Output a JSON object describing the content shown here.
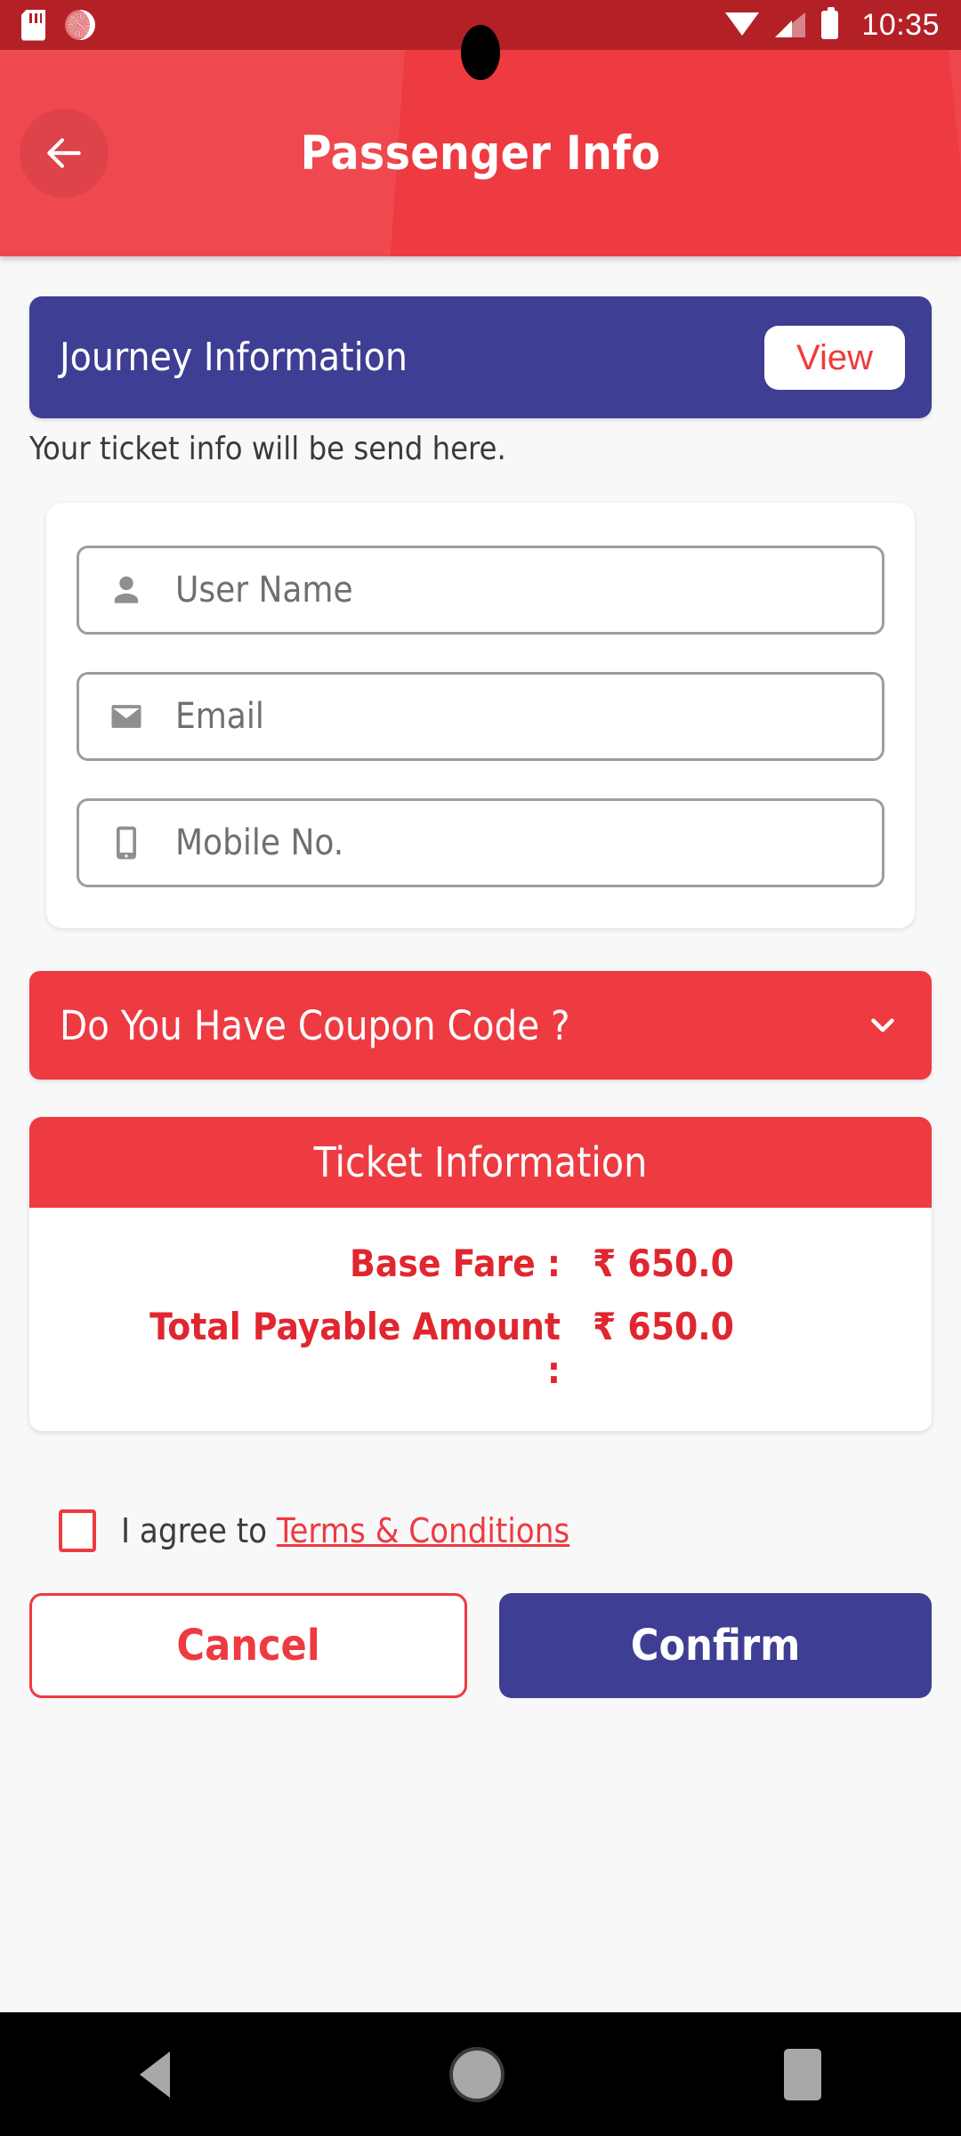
{
  "status_bar": {
    "time": "10:35",
    "left_icons": [
      "sd-card-icon",
      "brightness-icon"
    ],
    "right_icons": [
      "wifi-icon",
      "signal-icon",
      "battery-icon"
    ],
    "background_color": "#b32127"
  },
  "app_bar": {
    "title": "Passenger Info",
    "back_icon": "arrow-left-icon",
    "background_color": "#ee3a41"
  },
  "journey": {
    "title": "Journey Information",
    "view_label": "View",
    "note": "Your ticket info will be send here.",
    "card_color": "#3e3e94"
  },
  "form": {
    "fields": [
      {
        "icon": "person-icon",
        "placeholder": "User Name",
        "value": ""
      },
      {
        "icon": "envelope-icon",
        "placeholder": "Email",
        "value": ""
      },
      {
        "icon": "mobile-icon",
        "placeholder": "Mobile No.",
        "value": ""
      }
    ]
  },
  "coupon": {
    "label": "Do You Have Coupon Code ?",
    "chevron_icon": "chevron-down-icon",
    "expanded": false,
    "background_color": "#ee3a41"
  },
  "ticket_information": {
    "header": "Ticket Information",
    "rows": [
      {
        "label": "Base Fare :",
        "value": "₹ 650.0"
      },
      {
        "label": "Total Payable Amount :",
        "value": "₹ 650.0"
      }
    ],
    "accent_color": "#e0262e"
  },
  "terms": {
    "checked": false,
    "prefix": "I agree to ",
    "link_label": "Terms & Conditions",
    "accent_color": "#ee3a41"
  },
  "actions": {
    "cancel_label": "Cancel",
    "confirm_label": "Confirm",
    "confirm_color": "#3e3e94",
    "cancel_color": "#ee3a41"
  },
  "navigation_bar": {
    "back_icon": "nav-back-icon",
    "home_icon": "nav-home-icon",
    "recents_icon": "nav-recents-icon"
  }
}
